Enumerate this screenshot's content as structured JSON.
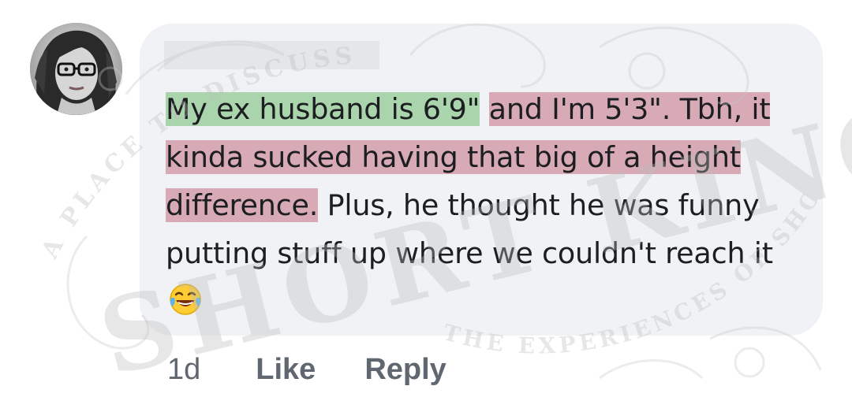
{
  "comment": {
    "author_name": "",
    "avatar_icon": "profile-photo-woman-glasses",
    "segments": [
      {
        "text": "My ex husband is 6'9\"",
        "highlight": "green"
      },
      {
        "text": " ",
        "highlight": "none"
      },
      {
        "text": "and I'm 5'3\". Tbh, it kinda sucked having that big of a height difference.",
        "highlight": "red"
      },
      {
        "text": " Plus, he thought he was funny putting stuff up where we couldn't reach it ",
        "highlight": "none"
      }
    ],
    "emoji_icon": "face-with-tears-of-joy-emoji",
    "highlight_colors": {
      "green": "#80c480",
      "red": "#c47080"
    }
  },
  "actions": {
    "timestamp": "1d",
    "like_label": "Like",
    "reply_label": "Reply"
  },
  "watermark": {
    "brand": "SHORT KINGZ",
    "arc_top": "A PLACE TO DISCUSS",
    "arc_bottom": "THE EXPERIENCES OF SHORTER MEN"
  },
  "colors": {
    "bubble": "#f0f2f5",
    "text": "#1c1e21",
    "action_text": "#606770",
    "name_placeholder": "#e4e6e9"
  }
}
